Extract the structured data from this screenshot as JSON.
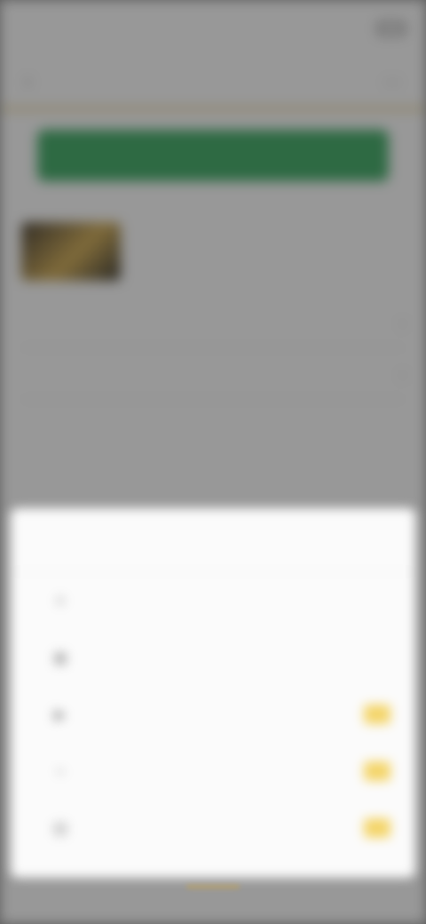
{
  "status_bar": {
    "time": "",
    "signal": "",
    "wifi": ""
  },
  "header": {
    "back_glyph": "‹",
    "title": "",
    "more_glyph": "⋯"
  },
  "primary_action": {
    "label": ""
  },
  "hint_text": "",
  "section": {
    "title": "",
    "more": ""
  },
  "article": {
    "title": ""
  },
  "rows": [
    {
      "label": "",
      "chevron": "›"
    },
    {
      "label": "",
      "chevron": "›"
    }
  ],
  "sheet": {
    "title": "",
    "options": [
      {
        "icon": "text-icon",
        "glyph": "≡",
        "label": "",
        "badge": "",
        "has_badge": false
      },
      {
        "icon": "image-icon",
        "glyph": "▣",
        "label": "",
        "badge": "",
        "has_badge": false
      },
      {
        "icon": "video-icon",
        "glyph": "▶",
        "label": "",
        "badge": "",
        "has_badge": true
      },
      {
        "icon": "link-icon",
        "glyph": "⌁",
        "label": "",
        "badge": "",
        "has_badge": true
      },
      {
        "icon": "document-icon",
        "glyph": "▤",
        "label": "",
        "badge": "",
        "has_badge": true
      }
    ]
  },
  "colors": {
    "accent_green": "#34a05a",
    "badge_yellow": "#f4d56a",
    "divider_gold": "#d8b85a"
  }
}
